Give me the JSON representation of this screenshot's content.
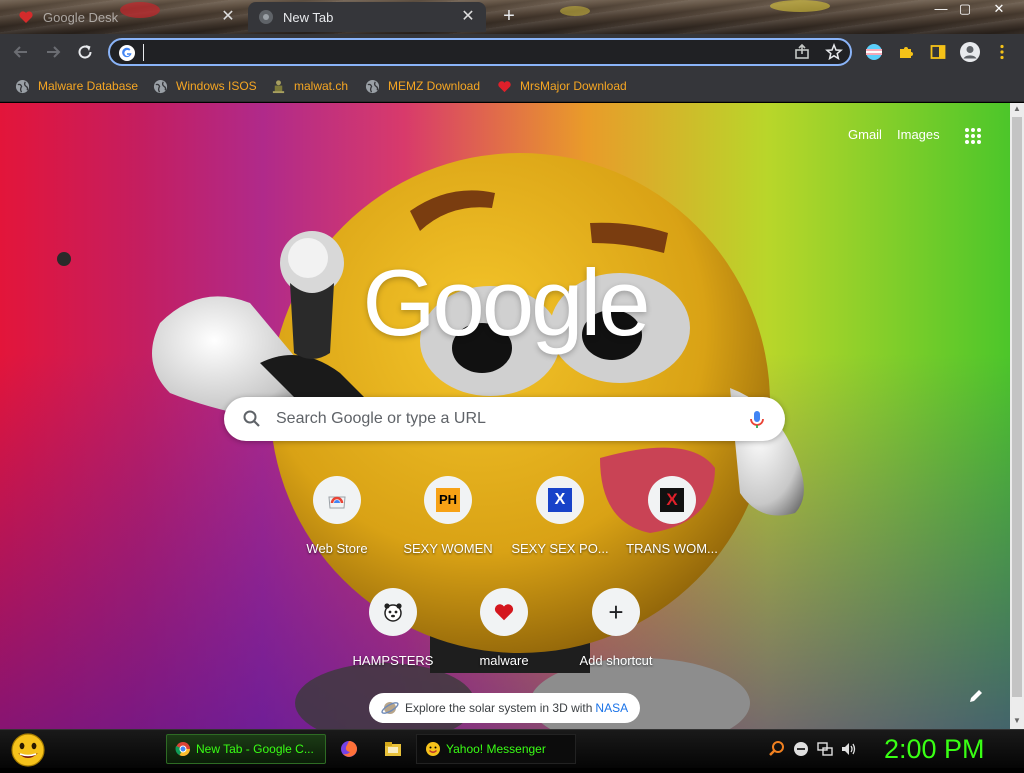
{
  "tabs": [
    {
      "title": "Google Desk",
      "icon": "heart-icon",
      "closable": true
    },
    {
      "title": "New Tab",
      "icon": "chrome-icon",
      "closable": true,
      "active": true
    }
  ],
  "window_controls": {
    "minimize": "—",
    "maximize": "▢",
    "close": "✕"
  },
  "omnibox": {
    "value": "",
    "placeholder": ""
  },
  "bookmarks": [
    {
      "label": "Malware Database",
      "icon": "globe-icon"
    },
    {
      "label": "Windows ISOS",
      "icon": "globe-icon"
    },
    {
      "label": "malwat.ch",
      "icon": "figure-icon"
    },
    {
      "label": "MEMZ Download",
      "icon": "globe-icon"
    },
    {
      "label": "MrsMajor Download",
      "icon": "heart-icon"
    }
  ],
  "page": {
    "links": {
      "gmail": "Gmail",
      "images": "Images"
    },
    "logo": "Google",
    "search_placeholder": "Search Google or type a URL",
    "shortcuts": [
      {
        "label": "Web Store",
        "icon": "web-store-icon"
      },
      {
        "label": "SEXY WOMEN",
        "icon": "ph-icon",
        "icon_text": "PH"
      },
      {
        "label": "SEXY SEX PO...",
        "icon": "x-blue-icon",
        "icon_text": "X"
      },
      {
        "label": "TRANS WOM...",
        "icon": "x-red-icon",
        "icon_text": "X"
      },
      {
        "label": "HAMPSTERS",
        "icon": "hamster-icon"
      },
      {
        "label": "malware",
        "icon": "heart-icon"
      },
      {
        "label": "Add shortcut",
        "icon": "plus-icon",
        "icon_text": "+"
      }
    ],
    "promo": {
      "text": "Explore the solar system in 3D with",
      "link": "NASA"
    }
  },
  "taskbar": {
    "tasks": [
      {
        "label": "New Tab - Google C...",
        "icon": "chrome-icon",
        "active": true
      },
      {
        "label": "Yahoo! Messenger",
        "icon": "smiley-icon"
      }
    ],
    "clock": "2:00 PM"
  },
  "colors": {
    "chrome_bg": "#35363a",
    "omnibox_focus": "#8ab4f8",
    "bookmark_text": "#f5a623",
    "taskbar_text": "#39ff14"
  }
}
